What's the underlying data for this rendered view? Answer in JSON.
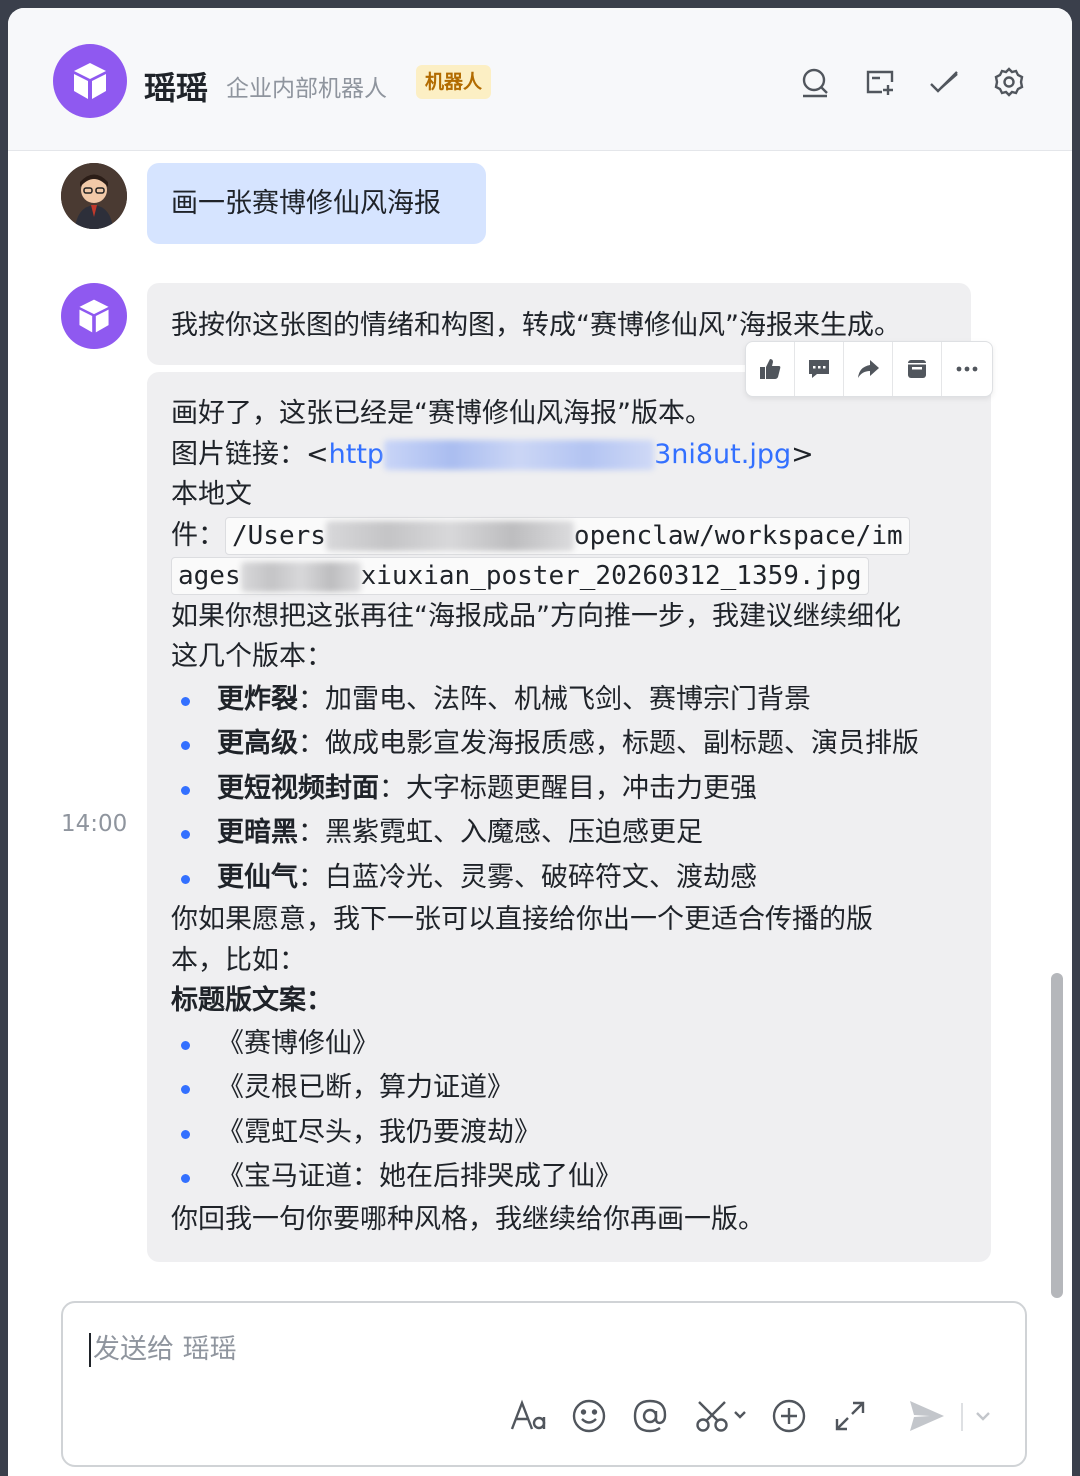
{
  "header": {
    "title": "瑶瑶",
    "subtitle": "企业内部机器人",
    "badge": "机器人",
    "icons": [
      "search-icon",
      "add-tab-icon",
      "done-icon",
      "settings-icon"
    ]
  },
  "messages": {
    "user_text": "画一张赛博修仙风海报",
    "bot_intro": "我按你这张图的情绪和构图，转成“赛博修仙风”海报来生成。",
    "time": "14:00",
    "reply": {
      "l1": "画好了，这张已经是“赛博修仙风海报”版本。",
      "l2_prefix": "图片链接：<",
      "l2_link_start": "http",
      "l2_link_end": "3ni8ut.jpg",
      "l2_suffix": ">",
      "l3": "本地文",
      "l4_prefix": "件：",
      "path_start": "/Users",
      "path_end": "openclaw/workspace/im",
      "path2_start": "ages",
      "path2_end": "xiuxian_poster_20260312_1359.jpg",
      "l6": "如果你想把这张再往“海报成品”方向推一步，我建议继续细化",
      "l7": "这几个版本：",
      "options": [
        {
          "bold": "更炸裂",
          "text": "：加雷电、法阵、机械飞剑、赛博宗门背景"
        },
        {
          "bold": "更高级",
          "text": "：做成电影宣发海报质感，标题、副标题、演员排版"
        },
        {
          "bold": "更短视频封面",
          "text": "：大字标题更醒目，冲击力更强"
        },
        {
          "bold": "更暗黑",
          "text": "：黑紫霓虹、入魔感、压迫感更足"
        },
        {
          "bold": "更仙气",
          "text": "：白蓝冷光、灵雾、破碎符文、渡劫感"
        }
      ],
      "l8": "你如果愿意，我下一张可以直接给你出一个更适合传播的版",
      "l9": "本，比如：",
      "titles_heading": "标题版文案：",
      "titles": [
        "《赛博修仙》",
        "《灵根已断，算力证道》",
        "《霓虹尽头，我仍要渡劫》",
        "《宝马证道：她在后排哭成了仙》"
      ],
      "closing": "你回我一句你要哪种风格，我继续给你再画一版。"
    }
  },
  "toolbar": [
    "thumbs-up-icon",
    "comment-icon",
    "forward-icon",
    "archive-icon",
    "more-icon"
  ],
  "composer": {
    "placeholder": "发送给 瑶瑶",
    "icons": [
      "font-format-icon",
      "emoji-icon",
      "mention-icon",
      "scissors-icon",
      "add-circle-icon",
      "expand-icon",
      "send-icon",
      "send-options-icon"
    ]
  },
  "colors": {
    "accent": "#3370ff",
    "bot_avatar": "#8f59f0",
    "user_bubble": "#d6e4ff",
    "bot_bubble": "#efeff1",
    "badge_bg": "#fcefc4",
    "badge_text": "#b26b00"
  }
}
